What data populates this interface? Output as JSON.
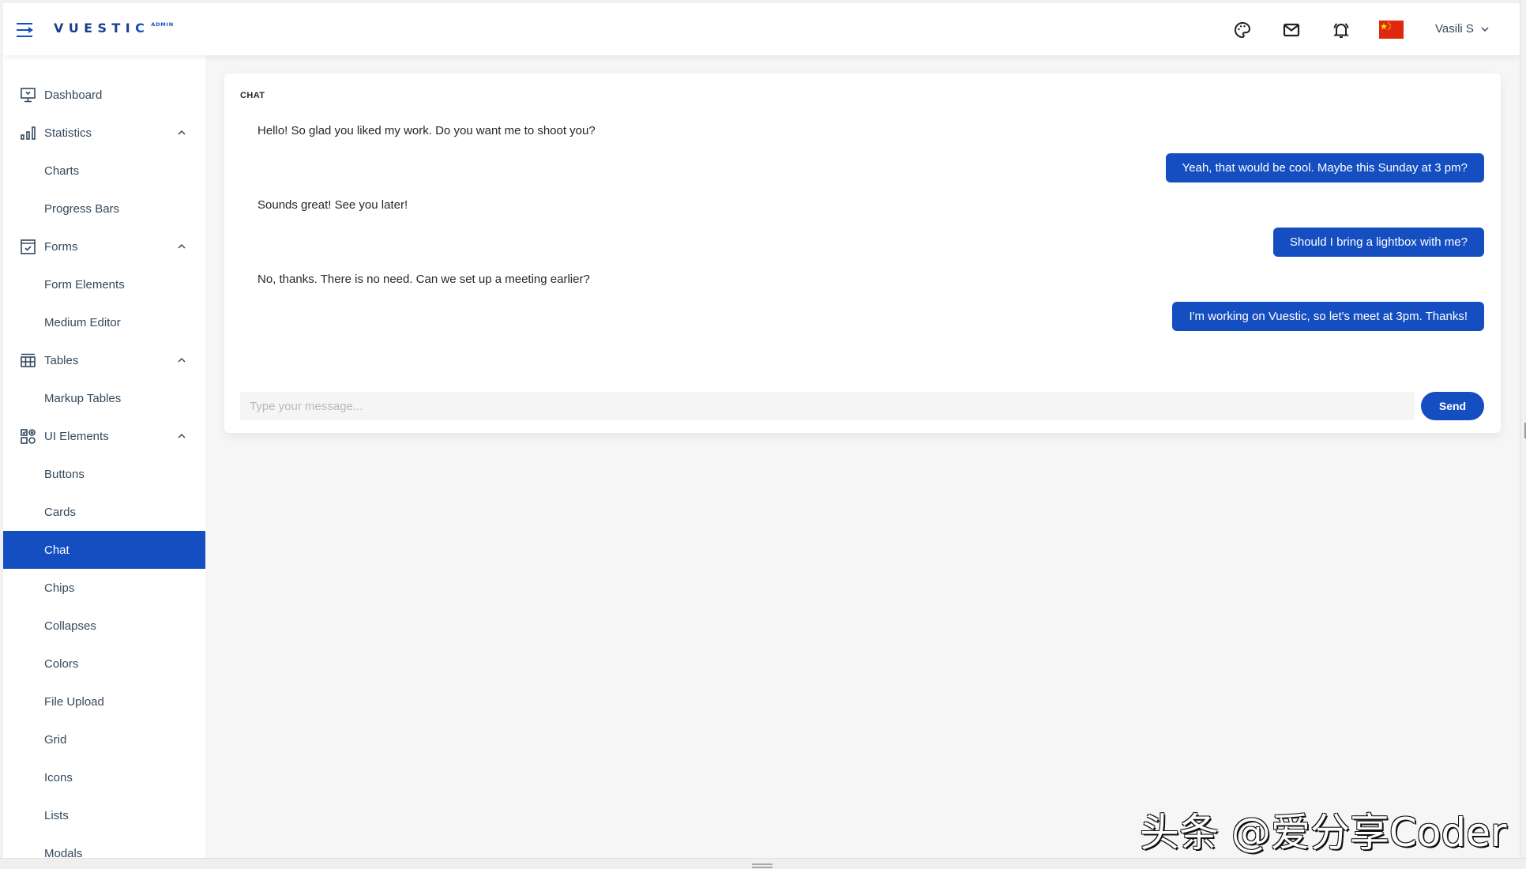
{
  "header": {
    "logo_main": "VUESTI",
    "logo_last": "C",
    "logo_sub": "ADMIN",
    "icons": [
      "menu-toggle-icon",
      "palette-icon",
      "mail-icon",
      "bell-icon",
      "china-flag-icon"
    ],
    "user_name": "Vasili S",
    "flag_color": "#de2910"
  },
  "sidebar": {
    "items": [
      {
        "label": "Dashboard",
        "icon": "dashboard-icon"
      },
      {
        "label": "Statistics",
        "icon": "statistics-icon",
        "expanded": true
      },
      {
        "label": "Charts"
      },
      {
        "label": "Progress Bars"
      },
      {
        "label": "Forms",
        "icon": "forms-icon",
        "expanded": true
      },
      {
        "label": "Form Elements"
      },
      {
        "label": "Medium Editor"
      },
      {
        "label": "Tables",
        "icon": "tables-icon",
        "expanded": true
      },
      {
        "label": "Markup Tables"
      },
      {
        "label": "UI Elements",
        "icon": "ui-elements-icon",
        "expanded": true
      },
      {
        "label": "Buttons"
      },
      {
        "label": "Cards"
      },
      {
        "label": "Chat",
        "active": true
      },
      {
        "label": "Chips"
      },
      {
        "label": "Collapses"
      },
      {
        "label": "Colors"
      },
      {
        "label": "File Upload"
      },
      {
        "label": "Grid"
      },
      {
        "label": "Icons"
      },
      {
        "label": "Lists"
      },
      {
        "label": "Modals"
      }
    ]
  },
  "chat": {
    "title": "CHAT",
    "messages": [
      {
        "side": "in",
        "text": "Hello! So glad you liked my work. Do you want me to shoot you?"
      },
      {
        "side": "out",
        "text": "Yeah, that would be cool. Maybe this Sunday at 3 pm?"
      },
      {
        "side": "in",
        "text": "Sounds great! See you later!"
      },
      {
        "side": "out",
        "text": "Should I bring a lightbox with me?"
      },
      {
        "side": "in",
        "text": "No, thanks. There is no need. Can we set up a meeting earlier?"
      },
      {
        "side": "out",
        "text": "I'm working on Vuestic, so let's meet at 3pm. Thanks!"
      }
    ],
    "input_value": "",
    "input_placeholder": "Type your message...",
    "send_label": "Send"
  },
  "colors": {
    "primary": "#154ec1",
    "text": "#34495e",
    "background": "#f6f6f6"
  },
  "watermark": "头条 @爱分享Coder"
}
